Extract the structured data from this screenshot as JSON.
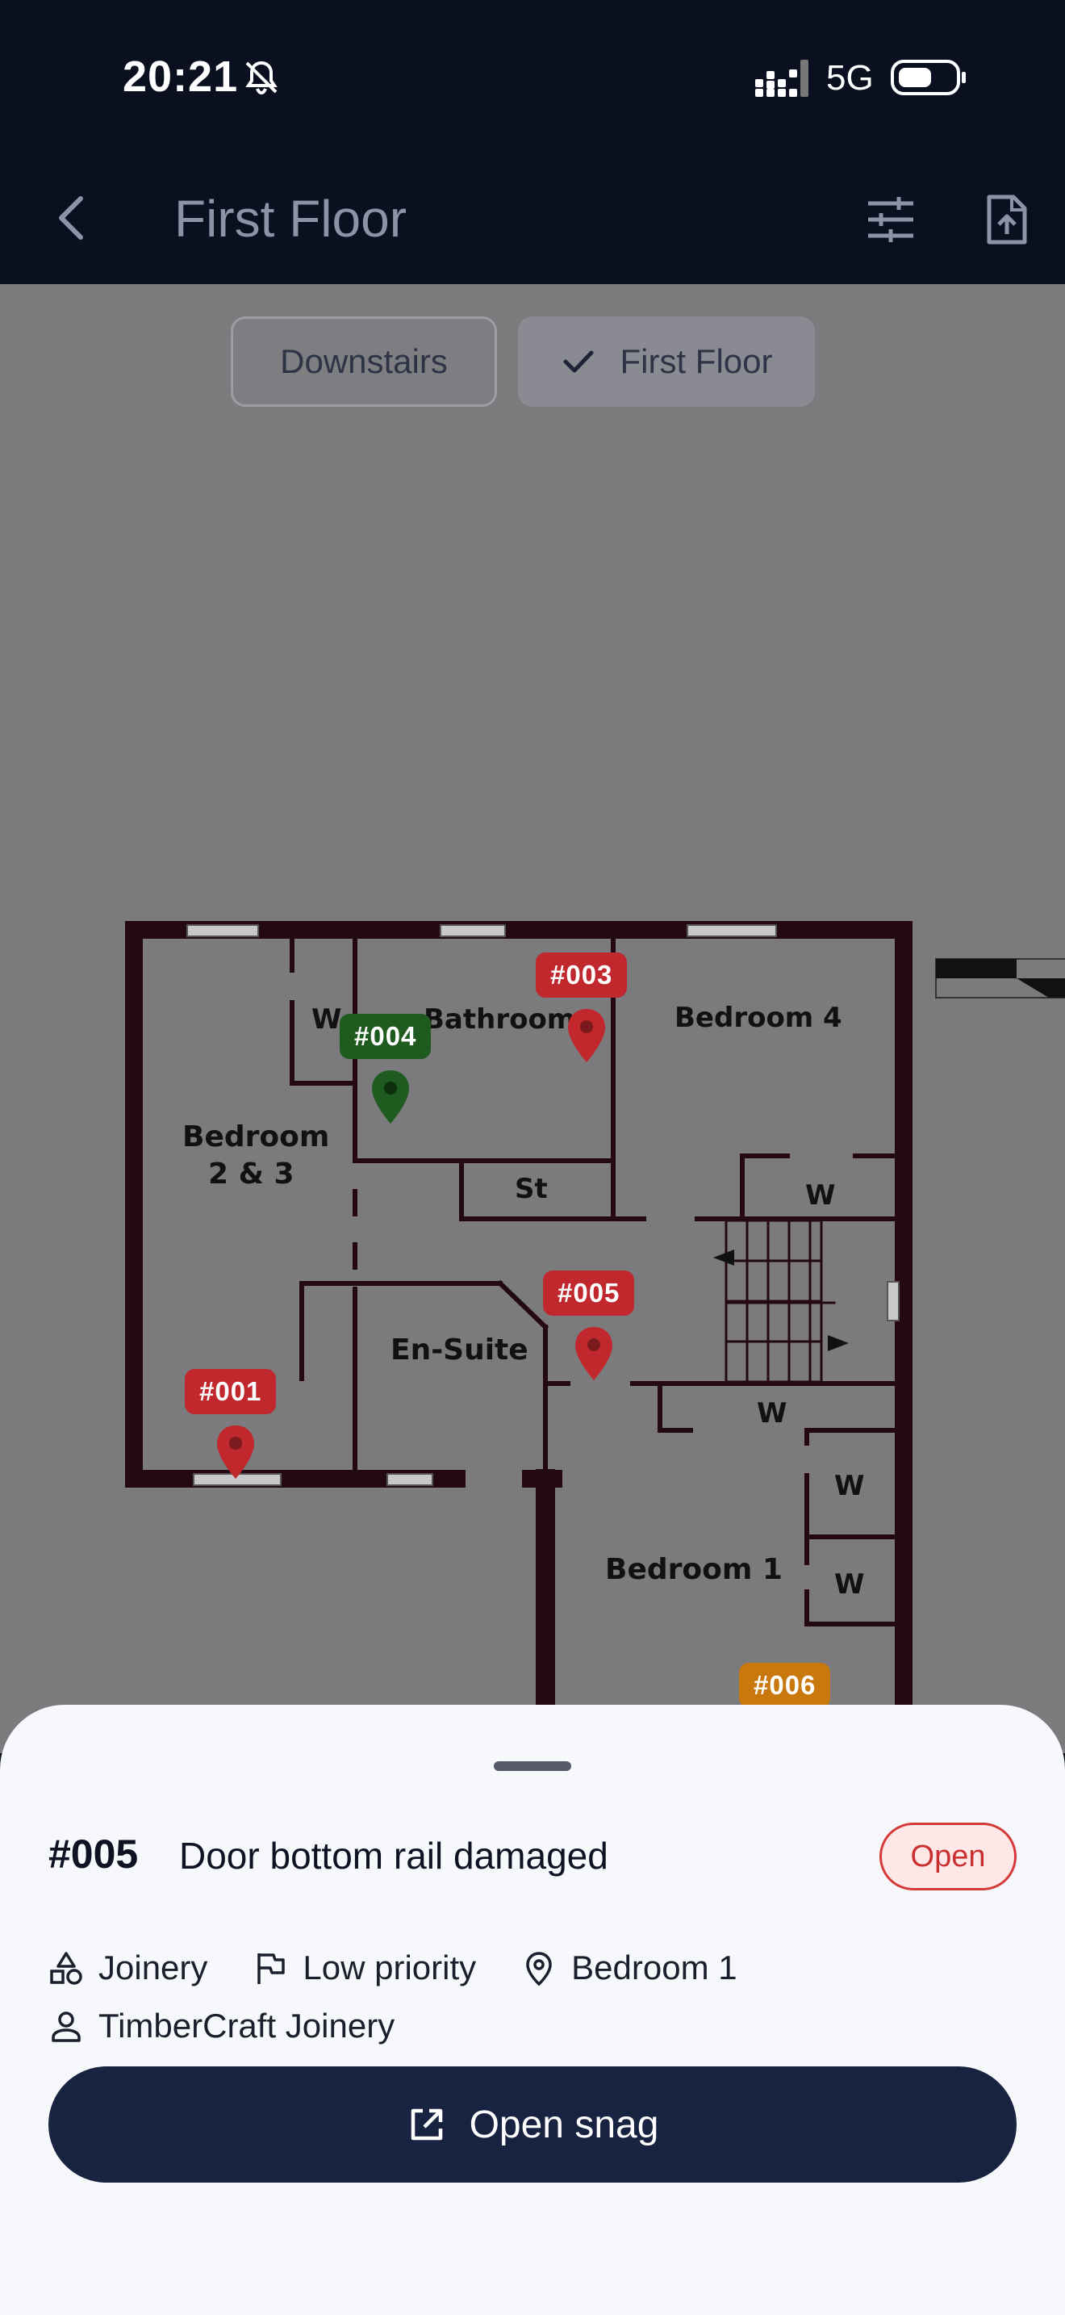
{
  "status_bar": {
    "time": "20:21",
    "network": "5G"
  },
  "app_bar": {
    "title": "First Floor"
  },
  "floor_chips": [
    {
      "label": "Downstairs",
      "selected": false
    },
    {
      "label": "First Floor",
      "selected": true
    }
  ],
  "plan_labels": {
    "bathroom": "Bathroom",
    "bedroom4": "Bedroom 4",
    "bedroom23_line1": "Bedroom",
    "bedroom23_line2": "2 & 3",
    "wardrobe": "W",
    "store": "St",
    "ensuite": "En-Suite",
    "bedroom1": "Bedroom 1"
  },
  "markers": [
    {
      "id": "#001",
      "color": "#c0282e"
    },
    {
      "id": "#003",
      "color": "#c0282e"
    },
    {
      "id": "#004",
      "color": "#1f5a1f"
    },
    {
      "id": "#005",
      "color": "#c0282e"
    },
    {
      "id": "#006",
      "color": "#c8780c"
    }
  ],
  "sheet": {
    "snag_id": "#005",
    "title": "Door bottom rail damaged",
    "status": "Open",
    "trade": "Joinery",
    "priority": "Low priority",
    "location": "Bedroom 1",
    "assignee": "TimberCraft Joinery",
    "button_label": "Open snag"
  },
  "colors": {
    "accent": "#172340",
    "open_status": "#d53a3a"
  }
}
